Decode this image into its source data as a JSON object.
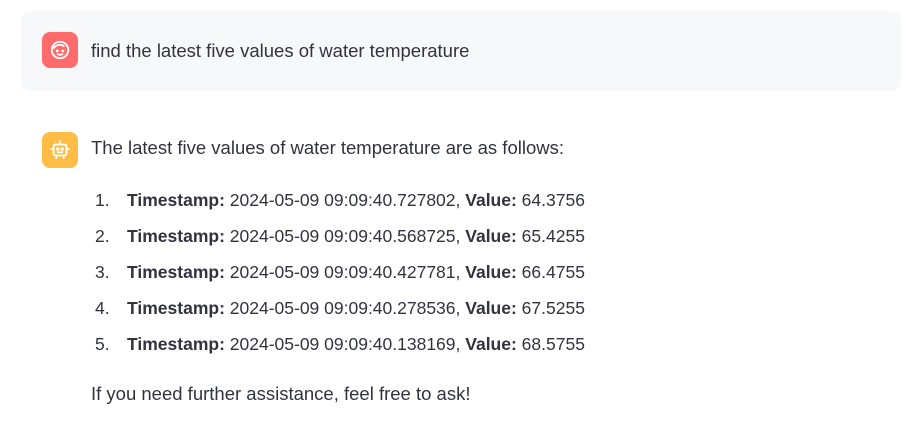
{
  "user_message": {
    "avatar_icon": "user-face-icon",
    "avatar_color": "#ff6b6b",
    "text": "find the latest five values of water temperature"
  },
  "assistant_message": {
    "avatar_icon": "robot-icon",
    "avatar_color": "#ffbd45",
    "intro": "The latest five values of water temperature are as follows:",
    "items": [
      {
        "number": "1.",
        "timestamp_label": "Timestamp:",
        "timestamp": " 2024-05-09 09:09:40.727802, ",
        "value_label": "Value:",
        "value": " 64.3756"
      },
      {
        "number": "2.",
        "timestamp_label": "Timestamp:",
        "timestamp": " 2024-05-09 09:09:40.568725, ",
        "value_label": "Value:",
        "value": " 65.4255"
      },
      {
        "number": "3.",
        "timestamp_label": "Timestamp:",
        "timestamp": " 2024-05-09 09:09:40.427781, ",
        "value_label": "Value:",
        "value": " 66.4755"
      },
      {
        "number": "4.",
        "timestamp_label": "Timestamp:",
        "timestamp": " 2024-05-09 09:09:40.278536, ",
        "value_label": "Value:",
        "value": " 67.5255"
      },
      {
        "number": "5.",
        "timestamp_label": "Timestamp:",
        "timestamp": " 2024-05-09 09:09:40.138169, ",
        "value_label": "Value:",
        "value": " 68.5755"
      }
    ],
    "outro": "If you need further assistance, feel free to ask!"
  }
}
